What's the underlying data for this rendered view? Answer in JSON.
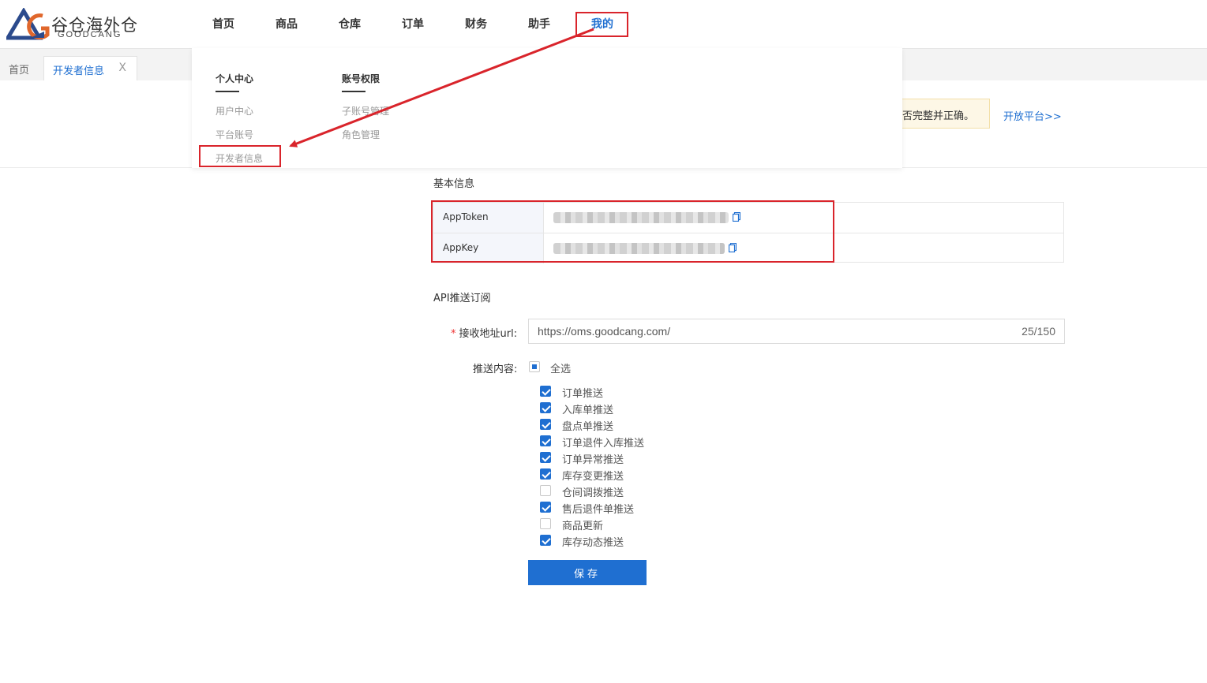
{
  "logo": {
    "cn": "谷仓海外仓",
    "en": "GOODCANG"
  },
  "nav": [
    {
      "label": "首页"
    },
    {
      "label": "商品"
    },
    {
      "label": "仓库"
    },
    {
      "label": "订单"
    },
    {
      "label": "财务"
    },
    {
      "label": "助手"
    },
    {
      "label": "我的"
    }
  ],
  "tabs": {
    "home": "首页",
    "current": "开发者信息",
    "close": "X"
  },
  "dropdown": {
    "col1": {
      "title": "个人中心",
      "items": [
        "用户中心",
        "平台账号",
        "开发者信息"
      ]
    },
    "col2": {
      "title": "账号权限",
      "items": [
        "子账号管理",
        "角色管理"
      ]
    }
  },
  "notice": {
    "text": "否完整并正确。"
  },
  "open_platform": "开放平台>>",
  "basic": {
    "title": "基本信息",
    "rows": [
      {
        "label": "AppToken"
      },
      {
        "label": "AppKey"
      }
    ]
  },
  "api": {
    "title": "API推送订阅",
    "url_label": "接收地址url:",
    "url_value": "https://oms.goodcang.com/",
    "url_count": "25/150",
    "push_label": "推送内容:",
    "select_all": "全选",
    "items": [
      {
        "label": "订单推送",
        "checked": true
      },
      {
        "label": "入库单推送",
        "checked": true
      },
      {
        "label": "盘点单推送",
        "checked": true
      },
      {
        "label": "订单退件入库推送",
        "checked": true
      },
      {
        "label": "订单异常推送",
        "checked": true
      },
      {
        "label": "库存变更推送",
        "checked": true
      },
      {
        "label": "仓间调拨推送",
        "checked": false
      },
      {
        "label": "售后退件单推送",
        "checked": true
      },
      {
        "label": "商品更新",
        "checked": false
      },
      {
        "label": "库存动态推送",
        "checked": true
      }
    ],
    "save": "保存"
  },
  "colors": {
    "accent": "#1f6fd1",
    "highlight": "#d9242b"
  }
}
